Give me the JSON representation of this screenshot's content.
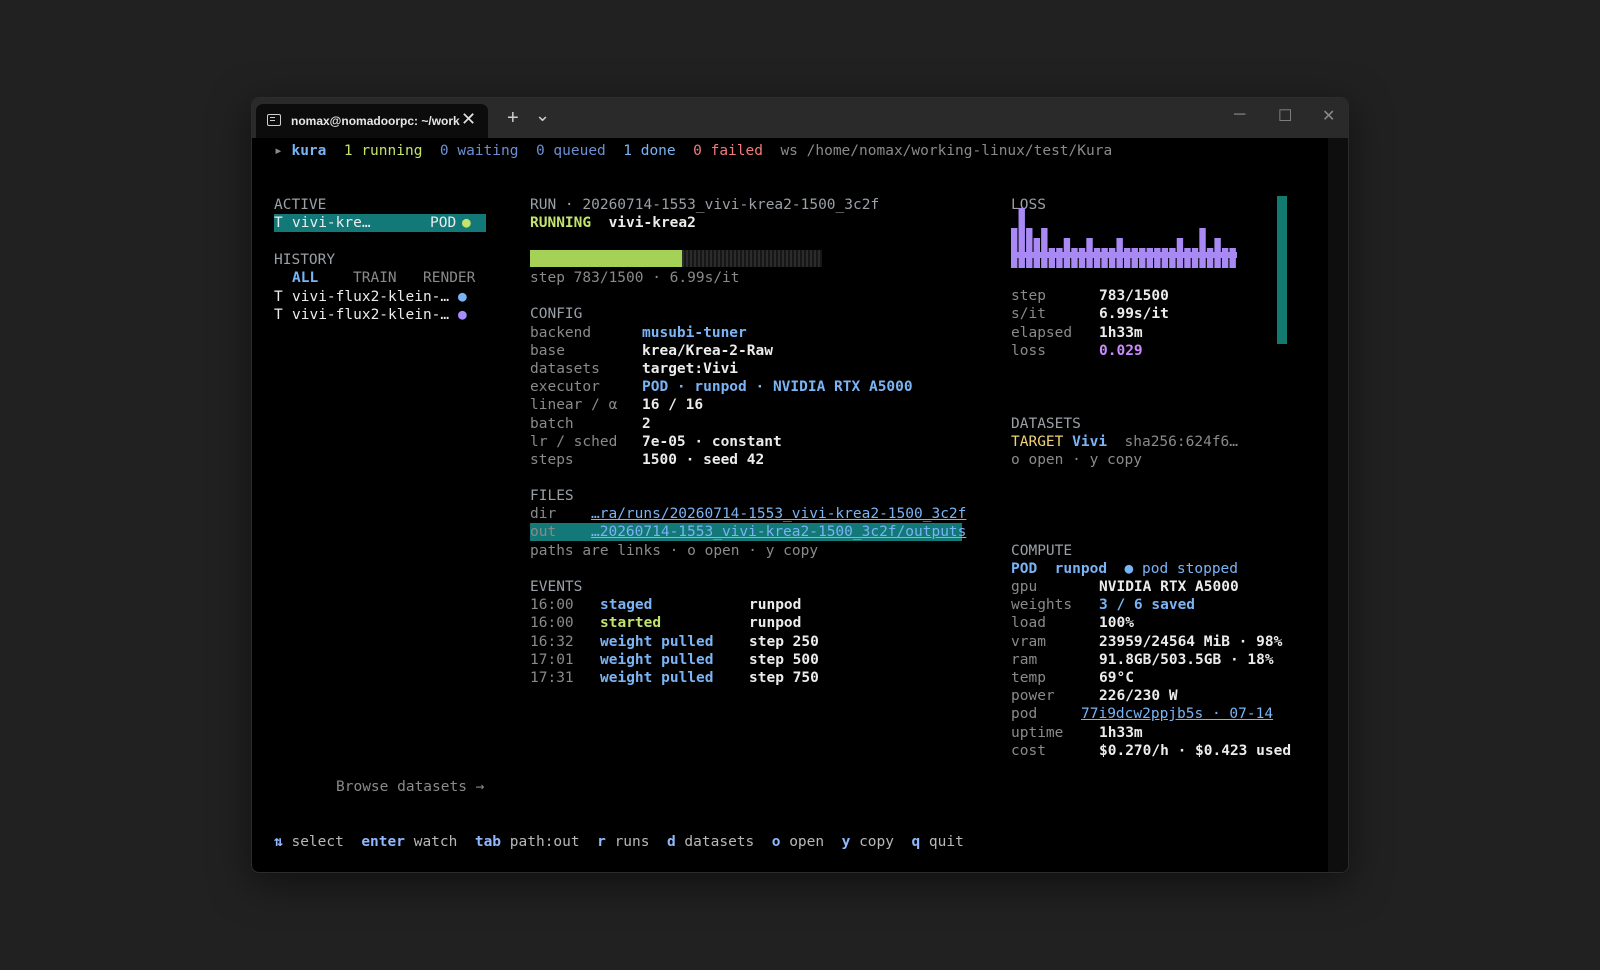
{
  "window": {
    "tab_title": "nomax@nomadoorpc: ~/work",
    "tab_close": "✕",
    "new_tab": "+",
    "dropdown": "⌄",
    "minimize": "─",
    "maximize": "☐",
    "close": "✕"
  },
  "status": {
    "arrow": "▸",
    "project": "kura",
    "running": "1 running",
    "waiting": "0 waiting",
    "queued": "0 queued",
    "done": "1 done",
    "failed": "0 failed",
    "ws_label": "ws",
    "ws_path": "/home/nomax/working-linux/test/Kura"
  },
  "active": {
    "heading": "ACTIVE",
    "item": {
      "type": "T",
      "name": "vivi-kre…",
      "executor": "POD",
      "dot": "●"
    }
  },
  "history": {
    "heading": "HISTORY",
    "filters": [
      "ALL",
      "TRAIN",
      "RENDER"
    ],
    "items": [
      {
        "type": "T",
        "name": "vivi-flux2-klein-…",
        "dot": "●",
        "dot_color": "#7ab4f5"
      },
      {
        "type": "T",
        "name": "vivi-flux2-klein-…",
        "dot": "●",
        "dot_color": "#a58cff"
      }
    ]
  },
  "browse": "Browse datasets →",
  "run": {
    "header": "RUN · 20260714-1553_vivi-krea2-1500_3c2f",
    "state": "RUNNING",
    "name": "vivi-krea2",
    "progress": 0.522,
    "step_line": "step 783/1500 · 6.99s/it"
  },
  "config": {
    "heading": "CONFIG",
    "rows": [
      {
        "key": "backend",
        "value": "musubi-tuner"
      },
      {
        "key": "base",
        "value": "krea/Krea-2-Raw"
      },
      {
        "key": "datasets",
        "value": "target:Vivi"
      },
      {
        "key": "executor",
        "value": "POD · runpod · NVIDIA RTX A5000"
      },
      {
        "key": "linear / α",
        "value": "16 / 16"
      },
      {
        "key": "batch",
        "value": "2"
      },
      {
        "key": "lr / sched",
        "value": "7e-05 · constant"
      },
      {
        "key": "steps",
        "value": "1500 · seed 42"
      }
    ]
  },
  "files": {
    "heading": "FILES",
    "dir_label": "dir",
    "dir_value": "…ra/runs/20260714-1553_vivi-krea2-1500_3c2f",
    "out_label": "out",
    "out_value": "…20260714-1553_vivi-krea2-1500_3c2f/outputs",
    "hint": "paths are links · o open · y copy"
  },
  "events": {
    "heading": "EVENTS",
    "rows": [
      {
        "time": "16:00",
        "event": "staged",
        "detail": "runpod"
      },
      {
        "time": "16:00",
        "event": "started",
        "detail": "runpod"
      },
      {
        "time": "16:32",
        "event": "weight pulled",
        "detail": "step 250"
      },
      {
        "time": "17:01",
        "event": "weight pulled",
        "detail": "step 500"
      },
      {
        "time": "17:31",
        "event": "weight pulled",
        "detail": "step 750"
      }
    ]
  },
  "loss": {
    "heading": "LOSS",
    "spark_levels": [
      3,
      5,
      3,
      2,
      3,
      1,
      1,
      2,
      1,
      1,
      2,
      1,
      1,
      1,
      2,
      1,
      1,
      1,
      1,
      1,
      1,
      1,
      2,
      1,
      1,
      3,
      1,
      2,
      1,
      1
    ],
    "rows": [
      {
        "key": "step",
        "value": "783/1500"
      },
      {
        "key": "s/it",
        "value": "6.99s/it"
      },
      {
        "key": "elapsed",
        "value": "1h33m"
      },
      {
        "key": "loss",
        "value": "0.029"
      }
    ]
  },
  "datasets": {
    "heading": "DATASETS",
    "role": "TARGET",
    "name": "Vivi",
    "hash": "sha256:624f6…",
    "hint": "o open · y copy"
  },
  "compute": {
    "heading": "COMPUTE",
    "executor": "POD",
    "provider": "runpod",
    "state": "● pod stopped",
    "rows": [
      {
        "key": "gpu",
        "value": "NVIDIA RTX A5000"
      },
      {
        "key": "weights",
        "value": "3 / 6 saved"
      },
      {
        "key": "load",
        "value": "100%"
      },
      {
        "key": "vram",
        "value": "23959/24564 MiB · 98%"
      },
      {
        "key": "ram",
        "value": "91.8GB/503.5GB · 18%"
      },
      {
        "key": "temp",
        "value": "69°C"
      },
      {
        "key": "power",
        "value": "226/230 W"
      },
      {
        "key": "pod",
        "value": "77i9dcw2ppjb5s · 07-14"
      },
      {
        "key": "uptime",
        "value": "1h33m"
      },
      {
        "key": "cost",
        "value": "$0.270/h · $0.423 used"
      }
    ]
  },
  "keys": [
    {
      "key": "⇅",
      "label": "select"
    },
    {
      "key": "enter",
      "label": "watch"
    },
    {
      "key": "tab",
      "label": "path:out"
    },
    {
      "key": "r",
      "label": "runs"
    },
    {
      "key": "d",
      "label": "datasets"
    },
    {
      "key": "o",
      "label": "open"
    },
    {
      "key": "y",
      "label": "copy"
    },
    {
      "key": "q",
      "label": "quit"
    }
  ],
  "colors": {
    "selection": "#127878",
    "progress": "#a5d156",
    "sparkline": "#a98af5"
  }
}
